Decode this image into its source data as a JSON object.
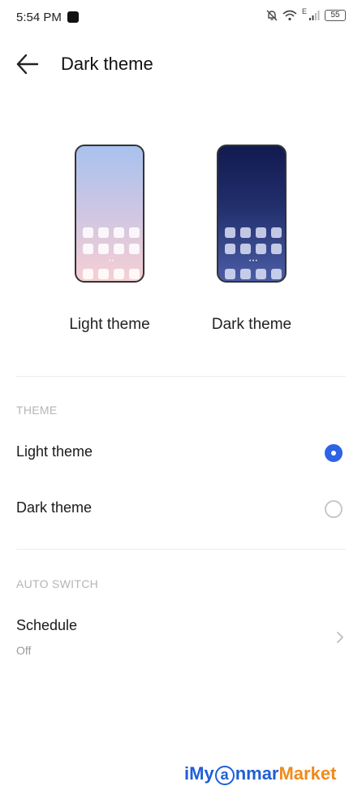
{
  "status_bar": {
    "time": "5:54 PM",
    "network_label": "E",
    "battery": "55"
  },
  "header": {
    "title": "Dark theme"
  },
  "previews": [
    {
      "label": "Light theme"
    },
    {
      "label": "Dark theme"
    }
  ],
  "theme_section": {
    "header": "THEME",
    "options": [
      {
        "label": "Light theme",
        "selected": true
      },
      {
        "label": "Dark theme",
        "selected": false
      }
    ]
  },
  "auto_switch_section": {
    "header": "AUTO SWITCH",
    "schedule_label": "Schedule",
    "schedule_value": "Off"
  },
  "watermark": {
    "part1": "iMy",
    "part2": "a",
    "part3": "nmar",
    "part4": "Market"
  },
  "colors": {
    "accent": "#2e63e4",
    "divider": "#ececec",
    "section_header": "#b5b5b5"
  }
}
